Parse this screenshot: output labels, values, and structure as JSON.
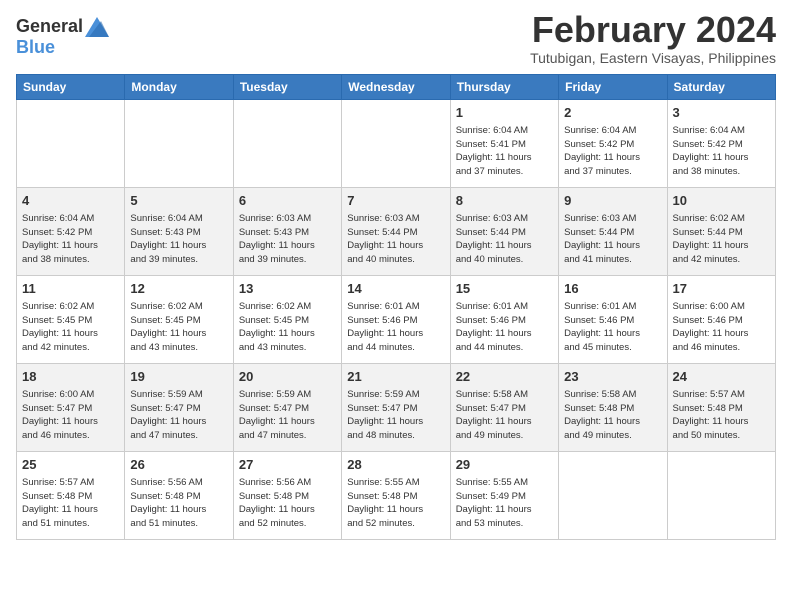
{
  "header": {
    "logo_general": "General",
    "logo_blue": "Blue",
    "month_year": "February 2024",
    "location": "Tutubigan, Eastern Visayas, Philippines"
  },
  "days_of_week": [
    "Sunday",
    "Monday",
    "Tuesday",
    "Wednesday",
    "Thursday",
    "Friday",
    "Saturday"
  ],
  "weeks": [
    [
      {
        "day": "",
        "info": ""
      },
      {
        "day": "",
        "info": ""
      },
      {
        "day": "",
        "info": ""
      },
      {
        "day": "",
        "info": ""
      },
      {
        "day": "1",
        "info": "Sunrise: 6:04 AM\nSunset: 5:41 PM\nDaylight: 11 hours\nand 37 minutes."
      },
      {
        "day": "2",
        "info": "Sunrise: 6:04 AM\nSunset: 5:42 PM\nDaylight: 11 hours\nand 37 minutes."
      },
      {
        "day": "3",
        "info": "Sunrise: 6:04 AM\nSunset: 5:42 PM\nDaylight: 11 hours\nand 38 minutes."
      }
    ],
    [
      {
        "day": "4",
        "info": "Sunrise: 6:04 AM\nSunset: 5:42 PM\nDaylight: 11 hours\nand 38 minutes."
      },
      {
        "day": "5",
        "info": "Sunrise: 6:04 AM\nSunset: 5:43 PM\nDaylight: 11 hours\nand 39 minutes."
      },
      {
        "day": "6",
        "info": "Sunrise: 6:03 AM\nSunset: 5:43 PM\nDaylight: 11 hours\nand 39 minutes."
      },
      {
        "day": "7",
        "info": "Sunrise: 6:03 AM\nSunset: 5:44 PM\nDaylight: 11 hours\nand 40 minutes."
      },
      {
        "day": "8",
        "info": "Sunrise: 6:03 AM\nSunset: 5:44 PM\nDaylight: 11 hours\nand 40 minutes."
      },
      {
        "day": "9",
        "info": "Sunrise: 6:03 AM\nSunset: 5:44 PM\nDaylight: 11 hours\nand 41 minutes."
      },
      {
        "day": "10",
        "info": "Sunrise: 6:02 AM\nSunset: 5:44 PM\nDaylight: 11 hours\nand 42 minutes."
      }
    ],
    [
      {
        "day": "11",
        "info": "Sunrise: 6:02 AM\nSunset: 5:45 PM\nDaylight: 11 hours\nand 42 minutes."
      },
      {
        "day": "12",
        "info": "Sunrise: 6:02 AM\nSunset: 5:45 PM\nDaylight: 11 hours\nand 43 minutes."
      },
      {
        "day": "13",
        "info": "Sunrise: 6:02 AM\nSunset: 5:45 PM\nDaylight: 11 hours\nand 43 minutes."
      },
      {
        "day": "14",
        "info": "Sunrise: 6:01 AM\nSunset: 5:46 PM\nDaylight: 11 hours\nand 44 minutes."
      },
      {
        "day": "15",
        "info": "Sunrise: 6:01 AM\nSunset: 5:46 PM\nDaylight: 11 hours\nand 44 minutes."
      },
      {
        "day": "16",
        "info": "Sunrise: 6:01 AM\nSunset: 5:46 PM\nDaylight: 11 hours\nand 45 minutes."
      },
      {
        "day": "17",
        "info": "Sunrise: 6:00 AM\nSunset: 5:46 PM\nDaylight: 11 hours\nand 46 minutes."
      }
    ],
    [
      {
        "day": "18",
        "info": "Sunrise: 6:00 AM\nSunset: 5:47 PM\nDaylight: 11 hours\nand 46 minutes."
      },
      {
        "day": "19",
        "info": "Sunrise: 5:59 AM\nSunset: 5:47 PM\nDaylight: 11 hours\nand 47 minutes."
      },
      {
        "day": "20",
        "info": "Sunrise: 5:59 AM\nSunset: 5:47 PM\nDaylight: 11 hours\nand 47 minutes."
      },
      {
        "day": "21",
        "info": "Sunrise: 5:59 AM\nSunset: 5:47 PM\nDaylight: 11 hours\nand 48 minutes."
      },
      {
        "day": "22",
        "info": "Sunrise: 5:58 AM\nSunset: 5:47 PM\nDaylight: 11 hours\nand 49 minutes."
      },
      {
        "day": "23",
        "info": "Sunrise: 5:58 AM\nSunset: 5:48 PM\nDaylight: 11 hours\nand 49 minutes."
      },
      {
        "day": "24",
        "info": "Sunrise: 5:57 AM\nSunset: 5:48 PM\nDaylight: 11 hours\nand 50 minutes."
      }
    ],
    [
      {
        "day": "25",
        "info": "Sunrise: 5:57 AM\nSunset: 5:48 PM\nDaylight: 11 hours\nand 51 minutes."
      },
      {
        "day": "26",
        "info": "Sunrise: 5:56 AM\nSunset: 5:48 PM\nDaylight: 11 hours\nand 51 minutes."
      },
      {
        "day": "27",
        "info": "Sunrise: 5:56 AM\nSunset: 5:48 PM\nDaylight: 11 hours\nand 52 minutes."
      },
      {
        "day": "28",
        "info": "Sunrise: 5:55 AM\nSunset: 5:48 PM\nDaylight: 11 hours\nand 52 minutes."
      },
      {
        "day": "29",
        "info": "Sunrise: 5:55 AM\nSunset: 5:49 PM\nDaylight: 11 hours\nand 53 minutes."
      },
      {
        "day": "",
        "info": ""
      },
      {
        "day": "",
        "info": ""
      }
    ]
  ]
}
